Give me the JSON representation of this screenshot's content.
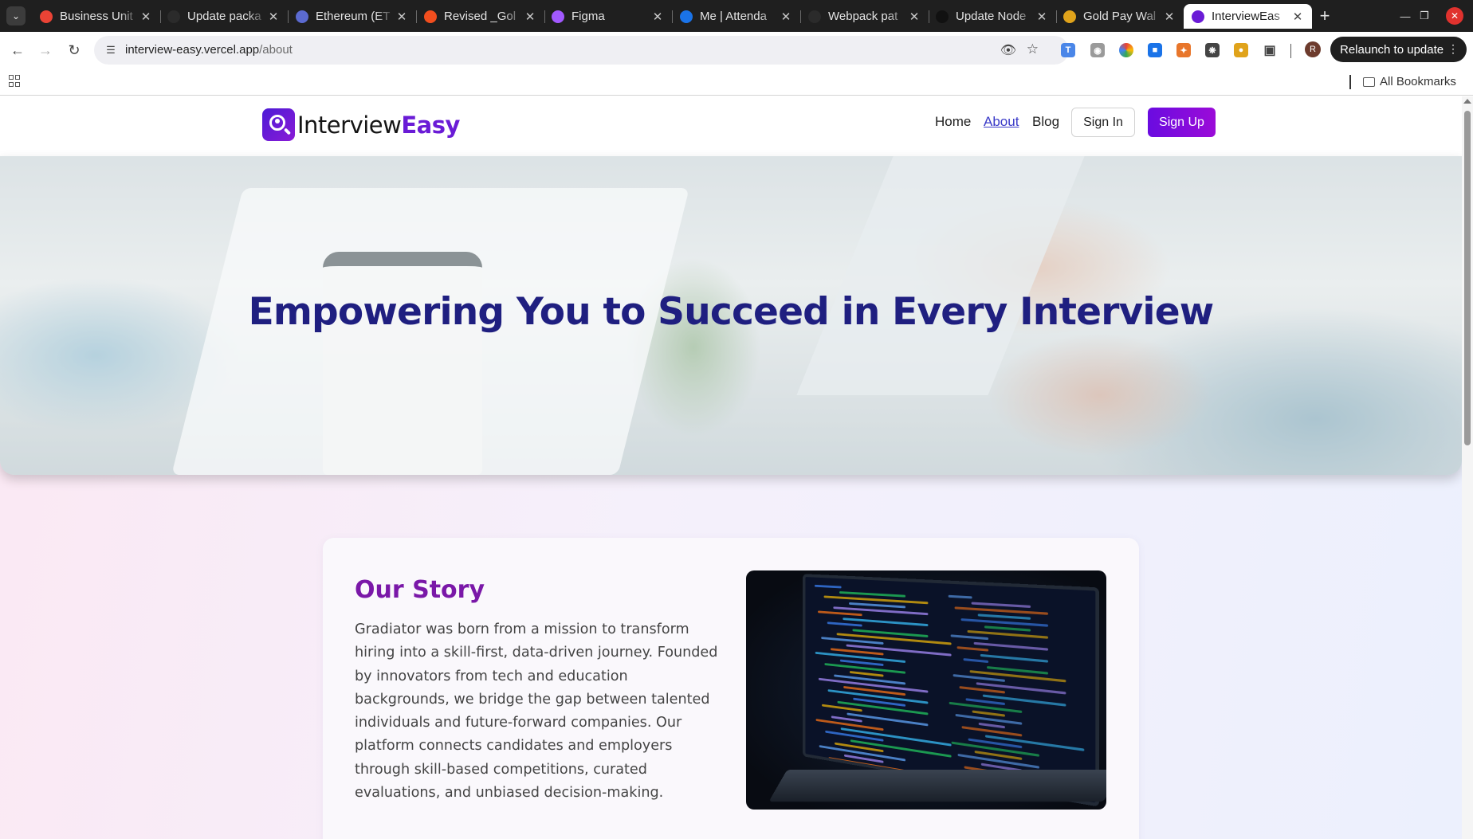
{
  "browser": {
    "tabs": [
      {
        "title": "Business Unit",
        "favicon": "gmail-icon",
        "color": "#ea4335"
      },
      {
        "title": "Update packa",
        "favicon": "github-icon",
        "color": "#2b2b2b"
      },
      {
        "title": "Ethereum (ET",
        "favicon": "ethereum-icon",
        "color": "#5b6ad0"
      },
      {
        "title": "Revised _Gol",
        "favicon": "figma-icon",
        "color": "#f24e1e"
      },
      {
        "title": "Figma",
        "favicon": "figma-icon",
        "color": "#a259ff"
      },
      {
        "title": "Me | Attenda",
        "favicon": "k-icon",
        "color": "#1a73e8"
      },
      {
        "title": "Webpack pat",
        "favicon": "github-icon",
        "color": "#2b2b2b"
      },
      {
        "title": "Update Node",
        "favicon": "k-dark-icon",
        "color": "#111111"
      },
      {
        "title": "Gold Pay Wal",
        "favicon": "goldpay-icon",
        "color": "#e0a31b"
      },
      {
        "title": "InterviewEas",
        "favicon": "intervieweasy-icon",
        "color": "#6a1bd6"
      }
    ],
    "address": {
      "host": "interview-easy.vercel.app",
      "path": "/about"
    },
    "relaunch_label": "Relaunch to update",
    "profile_initial": "R",
    "all_bookmarks_label": "All Bookmarks"
  },
  "site": {
    "logo": {
      "part1": "Interview",
      "part2": "Easy"
    },
    "nav": {
      "home": "Home",
      "about": "About",
      "blog": "Blog",
      "signin": "Sign In",
      "signup": "Sign Up"
    },
    "hero_title": "Empowering You to Succeed in Every Interview",
    "story": {
      "heading": "Our Story",
      "body": "Gradiator was born from a mission to transform hiring into a skill-first, data-driven journey. Founded by innovators from tech and education backgrounds, we bridge the gap between talented individuals and future-forward companies. Our platform connects candidates and employers through skill-based competitions, curated evaluations, and unbiased decision-making."
    }
  },
  "colors": {
    "brand": "#6a1bd6",
    "hero_title": "#1f1f80",
    "story_heading": "#7a18a8",
    "signup_bg": "#7a0bdc"
  }
}
